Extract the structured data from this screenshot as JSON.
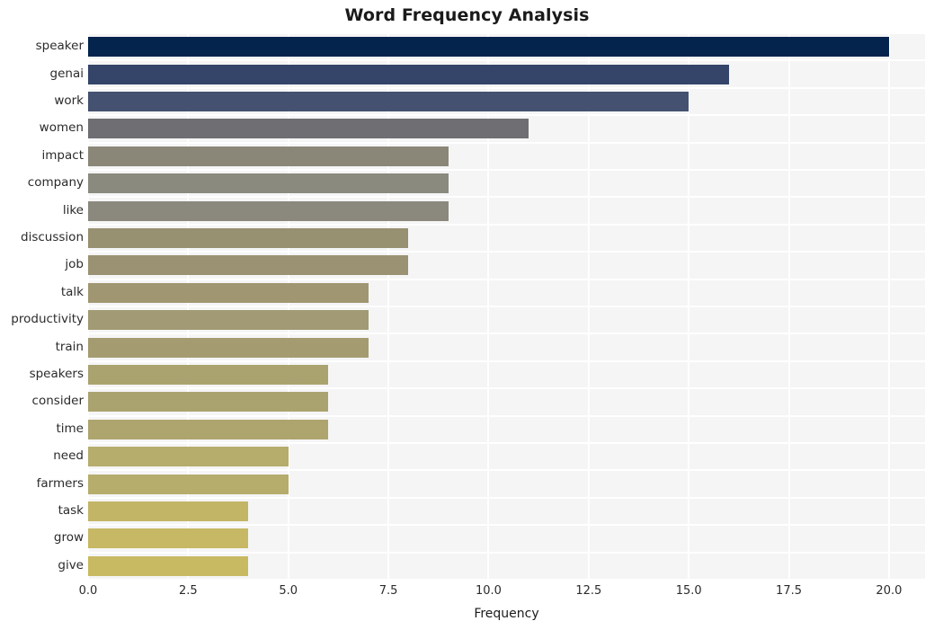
{
  "chart_data": {
    "type": "bar",
    "orientation": "horizontal",
    "title": "Word Frequency Analysis",
    "xlabel": "Frequency",
    "ylabel": "",
    "categories": [
      "speaker",
      "genai",
      "work",
      "women",
      "impact",
      "company",
      "like",
      "discussion",
      "job",
      "talk",
      "productivity",
      "train",
      "speakers",
      "consider",
      "time",
      "need",
      "farmers",
      "task",
      "grow",
      "give"
    ],
    "values": [
      20,
      16,
      15,
      11,
      9,
      9,
      9,
      8,
      8,
      7,
      7,
      7,
      6,
      6,
      6,
      5,
      5,
      4,
      4,
      4
    ],
    "xlim": [
      0,
      20.9
    ],
    "xticks": [
      "0.0",
      "2.5",
      "5.0",
      "7.5",
      "10.0",
      "12.5",
      "15.0",
      "17.5",
      "20.0"
    ],
    "xtick_values": [
      0,
      2.5,
      5,
      7.5,
      10,
      12.5,
      15,
      17.5,
      20
    ],
    "grid": true,
    "legend": false,
    "bar_colors": [
      "#04234d",
      "#344569",
      "#445170",
      "#6e6e73",
      "#8b8778",
      "#8b8a7e",
      "#8b897e",
      "#979071",
      "#9a9272",
      "#a09772",
      "#a29a74",
      "#a49b71",
      "#aba36f",
      "#aba36f",
      "#aea56e",
      "#b6ac6c",
      "#b6ac6c",
      "#c2b566",
      "#c6b864",
      "#c8b963"
    ],
    "plot_background": "#f5f5f6",
    "gridline_color": "#ffffff",
    "figure_background": "#ffffff"
  }
}
